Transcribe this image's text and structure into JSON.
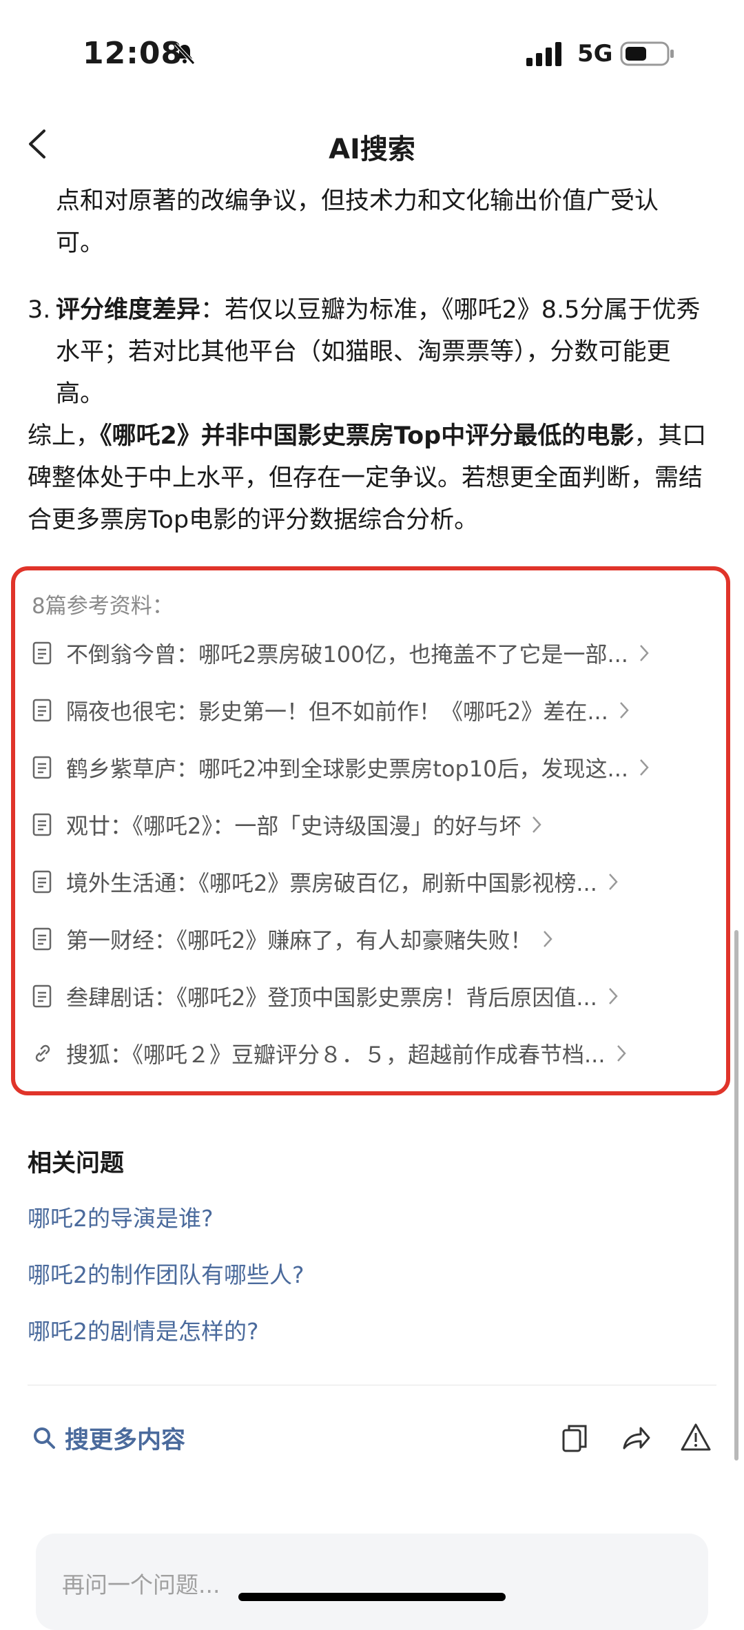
{
  "status_bar": {
    "time": "12:08",
    "network": "5G"
  },
  "nav": {
    "title": "AI搜索"
  },
  "answer": {
    "cont_line1": "点和对原著的改编争议，但技术力和文化输出价值广受认",
    "cont_line2": "可。",
    "item3_num": "3.",
    "item3_bold": "评分维度差异",
    "item3_text": "：若仅以豆瓣为标准，《哪吒2》8.5分属于优秀水平；若对比其他平台（如猫眼、淘票票等），分数可能更高。",
    "summary_prefix": "综上，",
    "summary_bold": "《哪吒2》并非中国影史票房Top中评分最低的电影",
    "summary_text": "，其口碑整体处于中上水平，但存在一定争议。若想更全面判断，需结合更多票房Top电影的评分数据综合分析。"
  },
  "references": {
    "title": "8篇参考资料：",
    "items": [
      {
        "label": "不倒翁今曾：哪吒2票房破100亿，也掩盖不了它是一部...",
        "icon": "document-icon"
      },
      {
        "label": "隔夜也很宅：影史第一！但不如前作！《哪吒2》差在...",
        "icon": "document-icon"
      },
      {
        "label": "鹤乡紫草庐：哪吒2冲到全球影史票房top10后，发现这...",
        "icon": "document-icon"
      },
      {
        "label": "观廿：《哪吒2》：一部「史诗级国漫」的好与坏",
        "icon": "document-icon"
      },
      {
        "label": "境外生活通：《哪吒2》票房破百亿，刷新中国影视榜...",
        "icon": "document-icon"
      },
      {
        "label": "第一财经：《哪吒2》赚麻了，有人却豪赌失败！",
        "icon": "document-icon"
      },
      {
        "label": "叁肆剧话：《哪吒2》登顶中国影史票房！背后原因值...",
        "icon": "document-icon"
      },
      {
        "label": "搜狐：《哪吒２》豆瓣评分８．５，超越前作成春节档...",
        "icon": "link-icon"
      }
    ]
  },
  "related": {
    "title": "相关问题",
    "questions": [
      "哪吒2的导演是谁?",
      "哪吒2的制作团队有哪些人?",
      "哪吒2的剧情是怎样的?"
    ]
  },
  "actions": {
    "search_more": "搜更多内容"
  },
  "input": {
    "placeholder": "再问一个问题..."
  },
  "colors": {
    "accent": "#4a6a9c",
    "highlight_border": "#e0342a",
    "muted_text": "#8a8a8a"
  }
}
